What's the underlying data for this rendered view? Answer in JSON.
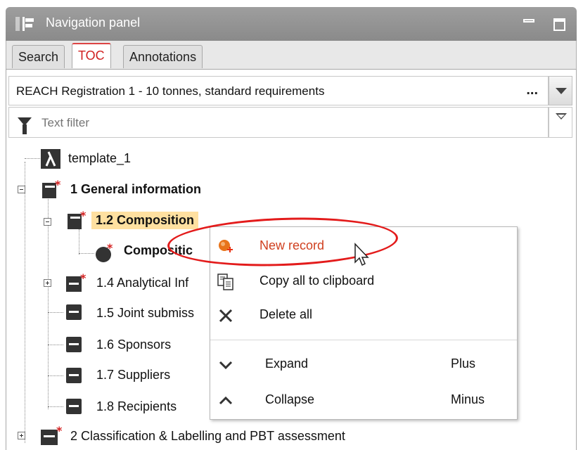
{
  "window": {
    "title": "Navigation panel"
  },
  "tabs": [
    {
      "label": "Search"
    },
    {
      "label": "TOC"
    },
    {
      "label": "Annotations"
    }
  ],
  "active_tab": "TOC",
  "template_select": {
    "value": "REACH Registration 1 - 10 tonnes, standard requirements",
    "dots": "..."
  },
  "filter": {
    "placeholder": "Text filter"
  },
  "tree": {
    "items": [
      {
        "label": "template_1"
      },
      {
        "label": "1 General information"
      },
      {
        "label": "1.2 Composition"
      },
      {
        "label": "Compositic"
      },
      {
        "label": "1.4 Analytical Inf"
      },
      {
        "label": "1.5 Joint submiss"
      },
      {
        "label": "1.6 Sponsors"
      },
      {
        "label": "1.7 Suppliers"
      },
      {
        "label": "1.8 Recipients"
      },
      {
        "label": "2 Classification & Labelling and PBT assessment"
      }
    ]
  },
  "context_menu": {
    "items": [
      {
        "label": "New record",
        "shortcut": ""
      },
      {
        "label": "Copy all to clipboard",
        "shortcut": ""
      },
      {
        "label": "Delete all",
        "shortcut": ""
      },
      {
        "label": "Expand",
        "shortcut": "Plus"
      },
      {
        "label": "Collapse",
        "shortcut": "Minus"
      }
    ]
  },
  "colors": {
    "accent_red": "#d02020",
    "highlight_ellipse": "#e31b1b",
    "selected_bg": "#ffe0a0",
    "title_bar": "#9a9a9a"
  }
}
